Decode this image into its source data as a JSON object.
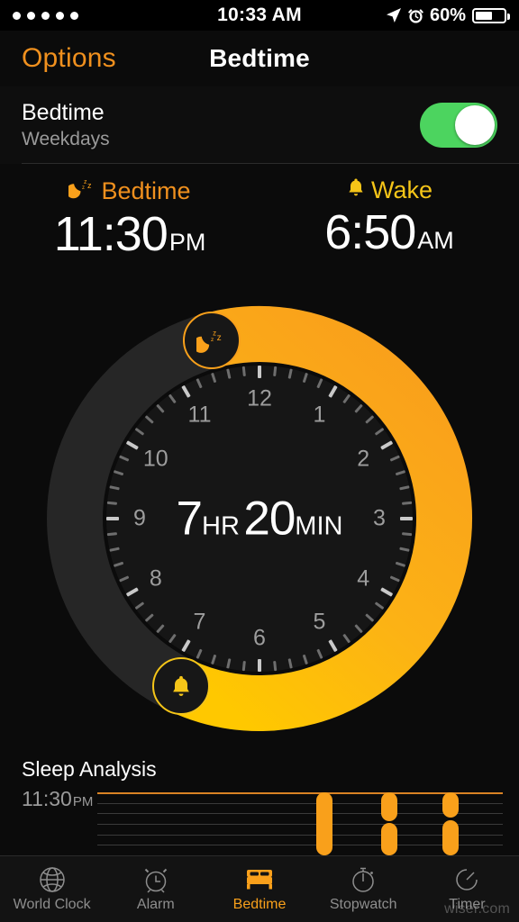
{
  "status_bar": {
    "signal_dots": 5,
    "time": "10:33 AM",
    "battery_percent": "60%",
    "battery_level": 60,
    "icons": [
      "location-arrow-icon",
      "alarm-icon",
      "battery-icon"
    ]
  },
  "nav": {
    "left_button": "Options",
    "title": "Bedtime"
  },
  "toggle_row": {
    "title": "Bedtime",
    "subtitle": "Weekdays",
    "enabled": true,
    "on_color": "#4cd45f"
  },
  "schedule": {
    "bedtime": {
      "label": "Bedtime",
      "icon": "moon-zzz-icon",
      "time": "11:30",
      "meridiem": "PM",
      "color": "#f0901e"
    },
    "wake": {
      "label": "Wake",
      "icon": "bell-icon",
      "time": "6:50",
      "meridiem": "AM",
      "color": "#f5c518"
    }
  },
  "dial": {
    "duration_hours": "7",
    "duration_hours_unit": "HR",
    "duration_minutes": "20",
    "duration_minutes_unit": "MIN",
    "hour_numbers": [
      "12",
      "1",
      "2",
      "3",
      "4",
      "5",
      "6",
      "7",
      "8",
      "9",
      "10",
      "11"
    ],
    "arc_start_deg": 345,
    "arc_end_deg": 205,
    "arc_color_start": "#f9a01b",
    "arc_color_end": "#ffc800",
    "track_color": "#262626",
    "bedtime_handle_icon": "moon-zzz-icon",
    "wake_handle_icon": "bell-icon"
  },
  "chart_data": {
    "type": "bar",
    "title": "Sleep Analysis",
    "categories": [
      "seg-1",
      "seg-2",
      "seg-3"
    ],
    "values": [
      100,
      100,
      100
    ],
    "axis_label": "11:30",
    "axis_label_suffix": "PM",
    "gridlines": 7,
    "bar_color": "#f9a01b",
    "series": [
      {
        "name": "segment-1",
        "x_pct": 54,
        "top_pct": 0,
        "height_pct": 100,
        "split": false
      },
      {
        "name": "segment-2",
        "x_pct": 70,
        "top_pct": 0,
        "height_pct": 100,
        "split": true,
        "split_at_pct": 47
      },
      {
        "name": "segment-3",
        "x_pct": 85,
        "top_pct": 0,
        "height_pct": 100,
        "split": true,
        "split_at_pct": 42
      }
    ]
  },
  "sleep_analysis": {
    "title": "Sleep Analysis",
    "start_time": "11:30",
    "start_meridiem": "PM"
  },
  "tabs": [
    {
      "label": "World Clock",
      "icon": "globe-icon",
      "active": false
    },
    {
      "label": "Alarm",
      "icon": "alarm-clock-icon",
      "active": false
    },
    {
      "label": "Bedtime",
      "icon": "bed-icon",
      "active": true
    },
    {
      "label": "Stopwatch",
      "icon": "stopwatch-icon",
      "active": false
    },
    {
      "label": "Timer",
      "icon": "timer-icon",
      "active": false
    }
  ],
  "watermark": "wiser.com"
}
